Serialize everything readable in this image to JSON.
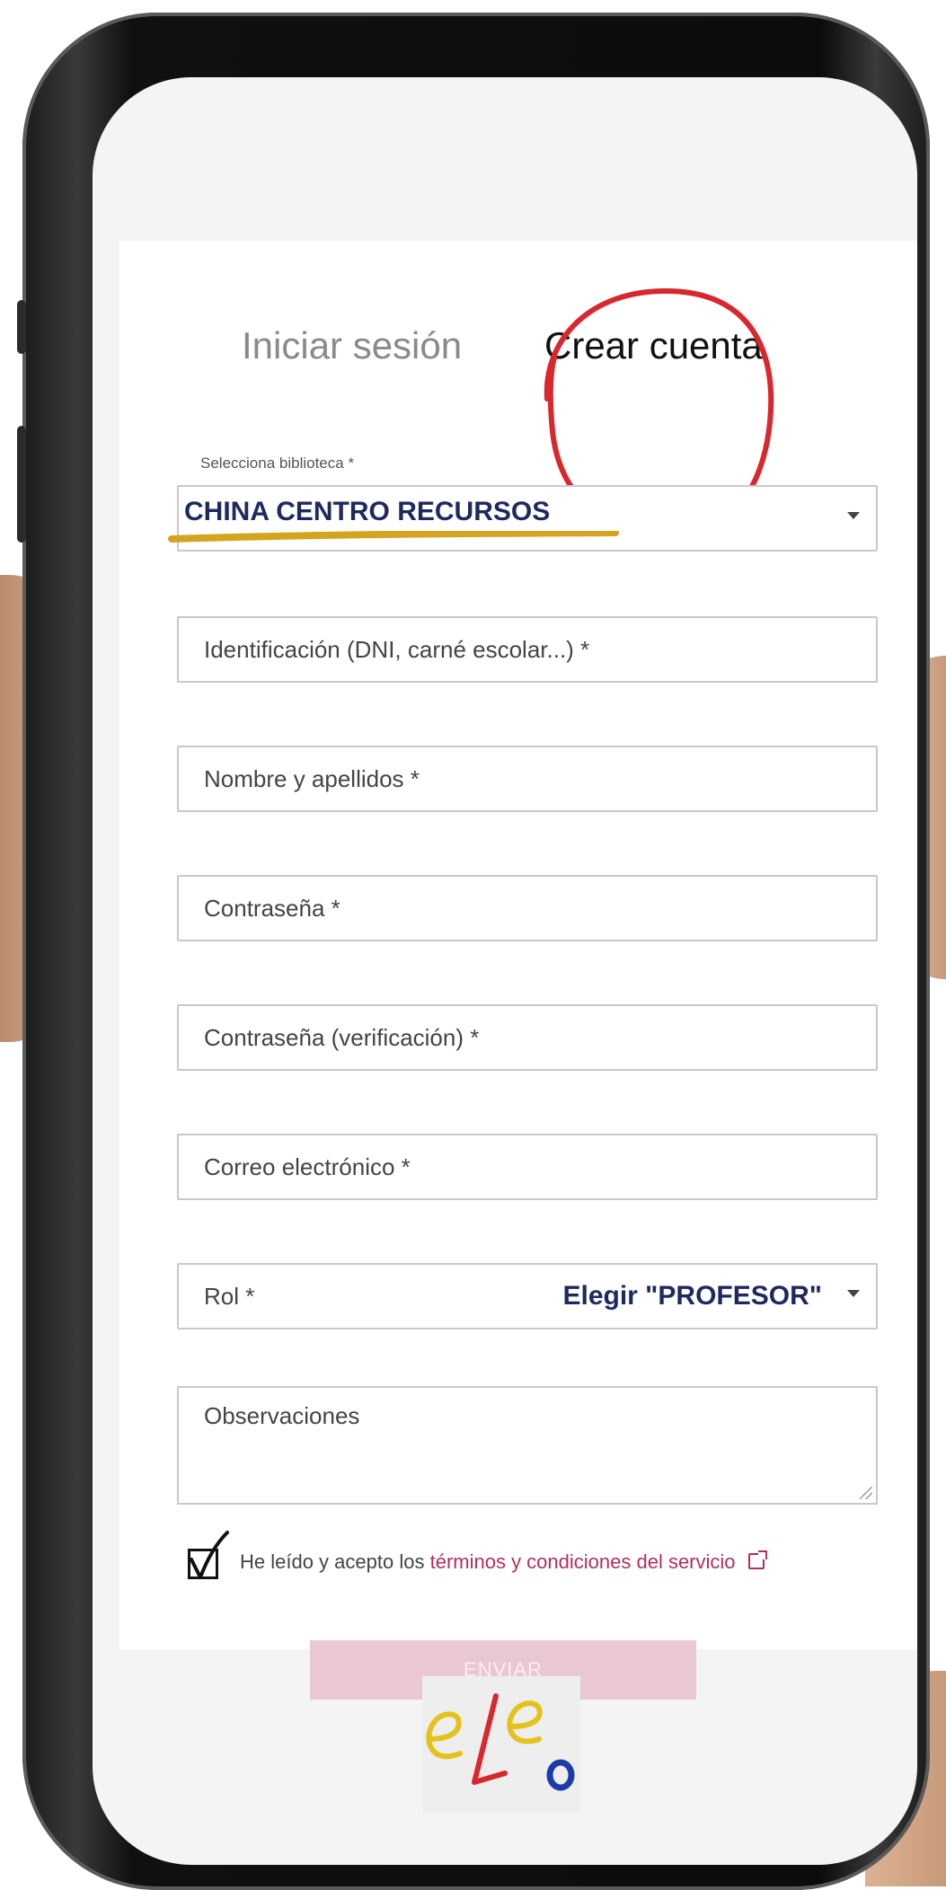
{
  "tabs": {
    "login_label": "Iniciar sesión",
    "create_label": "Crear cuenta"
  },
  "library": {
    "caption": "Selecciona biblioteca *",
    "selected": "CHINA CENTRO RECURSOS"
  },
  "fields": {
    "identification": "Identificación (DNI, carné escolar...) *",
    "full_name": "Nombre y apellidos *",
    "password": "Contraseña *",
    "password_verify": "Contraseña (verificación) *",
    "email": "Correo electrónico *",
    "role": "Rol *",
    "role_hint": "Elegir \"PROFESOR\"",
    "observations": "Observaciones"
  },
  "terms": {
    "checked": true,
    "prefix": "He leído y acepto los",
    "link": "términos y condiciones del servicio"
  },
  "submit_label": "ENVIAR",
  "colors": {
    "annotation_circle": "#d9272e",
    "annotation_underline": "#d4a420",
    "annotation_text": "#1e2a5e",
    "link": "#b0305e",
    "submit_bg": "#e9c8d3"
  }
}
